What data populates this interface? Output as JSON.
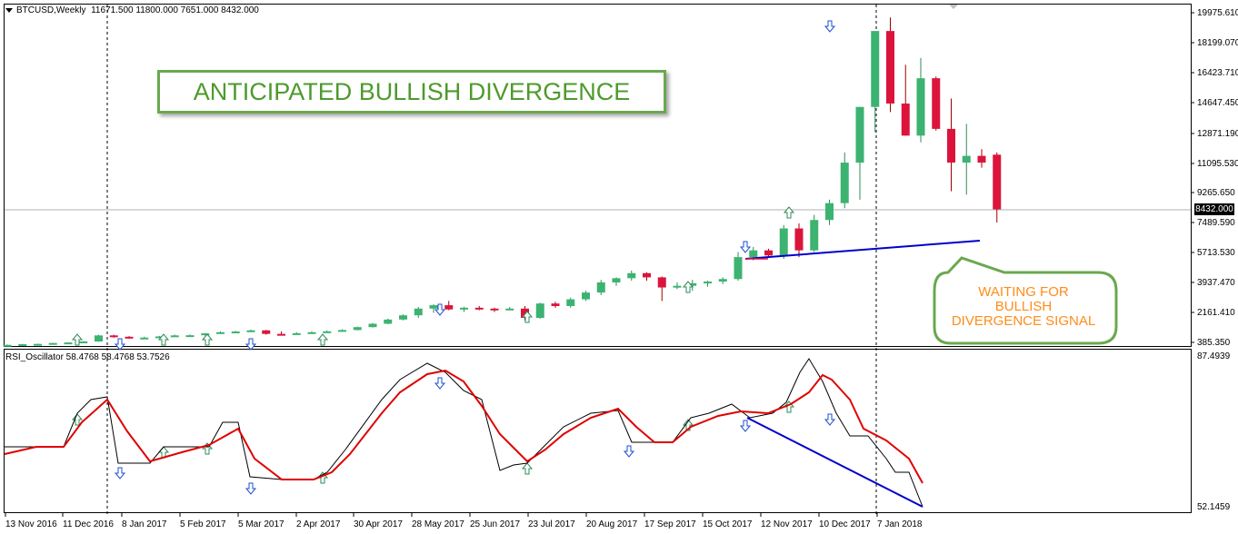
{
  "header": {
    "symbol": "BTCUSD,Weekly",
    "ohlc": "11671.500 11800.000 7651.000 8432.000"
  },
  "annotations": {
    "title_box": "ANTICIPATED BULLISH DIVERGENCE",
    "bubble_lines": [
      "WAITING FOR",
      "BULLISH",
      "DIVERGENCE SIGNAL"
    ]
  },
  "price_axis": {
    "labels": [
      "19975.610",
      "18199.070",
      "16423.710",
      "14647.450",
      "12871.190",
      "11095.530",
      "9265.650",
      "7489.590",
      "5713.530",
      "3937.470",
      "2161.410",
      "385.350"
    ],
    "current_price": "8432.000"
  },
  "indicator": {
    "label": "RSI_Oscillator 58.4768 58.4768 53.7526",
    "axis_labels": [
      "87.4939",
      "52.1459"
    ]
  },
  "time_axis": {
    "labels": [
      "13 Nov 2016",
      "11 Dec 2016",
      "8 Jan 2017",
      "5 Feb 2017",
      "5 Mar 2017",
      "2 Apr 2017",
      "30 Apr 2017",
      "28 May 2017",
      "25 Jun 2017",
      "23 Jul 2017",
      "20 Aug 2017",
      "17 Sep 2017",
      "15 Oct 2017",
      "12 Nov 2017",
      "10 Dec 2017",
      "7 Jan 2018"
    ]
  },
  "colors": {
    "bull": "#3cb371",
    "bear": "#dc143c",
    "rsi_fast": "#000000",
    "rsi_slow": "#e00000",
    "trendline": "#0000cc",
    "accent_green": "#6aa84f",
    "bubble_text": "#ff8c1a"
  },
  "chart_data": {
    "type": "candlestick",
    "candles": [
      {
        "o": 385,
        "h": 420,
        "l": 370,
        "c": 400
      },
      {
        "o": 400,
        "h": 460,
        "l": 390,
        "c": 440
      },
      {
        "o": 440,
        "h": 470,
        "l": 420,
        "c": 455
      },
      {
        "o": 455,
        "h": 520,
        "l": 440,
        "c": 510
      },
      {
        "o": 510,
        "h": 560,
        "l": 480,
        "c": 540
      },
      {
        "o": 540,
        "h": 620,
        "l": 520,
        "c": 600
      },
      {
        "o": 600,
        "h": 1000,
        "l": 580,
        "c": 960
      },
      {
        "o": 960,
        "h": 1000,
        "l": 820,
        "c": 880
      },
      {
        "o": 880,
        "h": 920,
        "l": 760,
        "c": 800
      },
      {
        "o": 800,
        "h": 880,
        "l": 780,
        "c": 830
      },
      {
        "o": 830,
        "h": 930,
        "l": 810,
        "c": 900
      },
      {
        "o": 900,
        "h": 1000,
        "l": 880,
        "c": 960
      },
      {
        "o": 960,
        "h": 1010,
        "l": 900,
        "c": 970
      },
      {
        "o": 970,
        "h": 1100,
        "l": 950,
        "c": 1080
      },
      {
        "o": 1080,
        "h": 1200,
        "l": 1050,
        "c": 1150
      },
      {
        "o": 1150,
        "h": 1230,
        "l": 1120,
        "c": 1190
      },
      {
        "o": 1190,
        "h": 1300,
        "l": 1160,
        "c": 1260
      },
      {
        "o": 1260,
        "h": 1280,
        "l": 1000,
        "c": 1050
      },
      {
        "o": 1050,
        "h": 1200,
        "l": 950,
        "c": 1020
      },
      {
        "o": 1020,
        "h": 1150,
        "l": 1000,
        "c": 1090
      },
      {
        "o": 1090,
        "h": 1200,
        "l": 1070,
        "c": 1150
      },
      {
        "o": 1150,
        "h": 1250,
        "l": 1130,
        "c": 1200
      },
      {
        "o": 1200,
        "h": 1320,
        "l": 1180,
        "c": 1280
      },
      {
        "o": 1280,
        "h": 1480,
        "l": 1260,
        "c": 1450
      },
      {
        "o": 1450,
        "h": 1700,
        "l": 1430,
        "c": 1650
      },
      {
        "o": 1650,
        "h": 1950,
        "l": 1620,
        "c": 1900
      },
      {
        "o": 1900,
        "h": 2200,
        "l": 1850,
        "c": 2150
      },
      {
        "o": 2150,
        "h": 2650,
        "l": 2000,
        "c": 2550
      },
      {
        "o": 2550,
        "h": 2800,
        "l": 2300,
        "c": 2750
      },
      {
        "o": 2750,
        "h": 3000,
        "l": 2450,
        "c": 2500
      },
      {
        "o": 2500,
        "h": 2650,
        "l": 2350,
        "c": 2600
      },
      {
        "o": 2600,
        "h": 2700,
        "l": 2450,
        "c": 2550
      },
      {
        "o": 2550,
        "h": 2600,
        "l": 2350,
        "c": 2500
      },
      {
        "o": 2500,
        "h": 2650,
        "l": 2450,
        "c": 2550
      },
      {
        "o": 2550,
        "h": 2700,
        "l": 1850,
        "c": 2000
      },
      {
        "o": 2000,
        "h": 2900,
        "l": 1950,
        "c": 2850
      },
      {
        "o": 2850,
        "h": 2950,
        "l": 2600,
        "c": 2700
      },
      {
        "o": 2700,
        "h": 3200,
        "l": 2600,
        "c": 3100
      },
      {
        "o": 3100,
        "h": 3600,
        "l": 3000,
        "c": 3500
      },
      {
        "o": 3500,
        "h": 4250,
        "l": 3350,
        "c": 4100
      },
      {
        "o": 4100,
        "h": 4400,
        "l": 3900,
        "c": 4350
      },
      {
        "o": 4350,
        "h": 4800,
        "l": 4200,
        "c": 4650
      },
      {
        "o": 4650,
        "h": 4700,
        "l": 4200,
        "c": 4400
      },
      {
        "o": 4400,
        "h": 4450,
        "l": 3000,
        "c": 3800
      },
      {
        "o": 3800,
        "h": 4100,
        "l": 3700,
        "c": 3900
      },
      {
        "o": 3900,
        "h": 4250,
        "l": 3600,
        "c": 4050
      },
      {
        "o": 4050,
        "h": 4200,
        "l": 3850,
        "c": 4150
      },
      {
        "o": 4150,
        "h": 4400,
        "l": 4000,
        "c": 4300
      },
      {
        "o": 4300,
        "h": 5900,
        "l": 4200,
        "c": 5600
      },
      {
        "o": 5600,
        "h": 6200,
        "l": 5400,
        "c": 6000
      },
      {
        "o": 6000,
        "h": 6100,
        "l": 5600,
        "c": 5700
      },
      {
        "o": 5700,
        "h": 7500,
        "l": 5500,
        "c": 7300
      },
      {
        "o": 7300,
        "h": 7600,
        "l": 5600,
        "c": 6000
      },
      {
        "o": 6000,
        "h": 8100,
        "l": 5900,
        "c": 7800
      },
      {
        "o": 7800,
        "h": 9000,
        "l": 7500,
        "c": 8800
      },
      {
        "o": 8800,
        "h": 11800,
        "l": 8500,
        "c": 11200
      },
      {
        "o": 11200,
        "h": 12000,
        "l": 9000,
        "c": 14500
      },
      {
        "o": 14500,
        "h": 17600,
        "l": 13000,
        "c": 19000
      },
      {
        "o": 19000,
        "h": 19800,
        "l": 14200,
        "c": 14700
      },
      {
        "o": 14700,
        "h": 17000,
        "l": 13000,
        "c": 12800
      },
      {
        "o": 12800,
        "h": 17400,
        "l": 12400,
        "c": 16200
      },
      {
        "o": 16200,
        "h": 16300,
        "l": 13100,
        "c": 13200
      },
      {
        "o": 13200,
        "h": 15000,
        "l": 9500,
        "c": 11200
      },
      {
        "o": 11200,
        "h": 13500,
        "l": 9300,
        "c": 11600
      },
      {
        "o": 11600,
        "h": 12000,
        "l": 10900,
        "c": 11200
      },
      {
        "o": 11670,
        "h": 11800,
        "l": 7651,
        "c": 8432
      }
    ]
  }
}
